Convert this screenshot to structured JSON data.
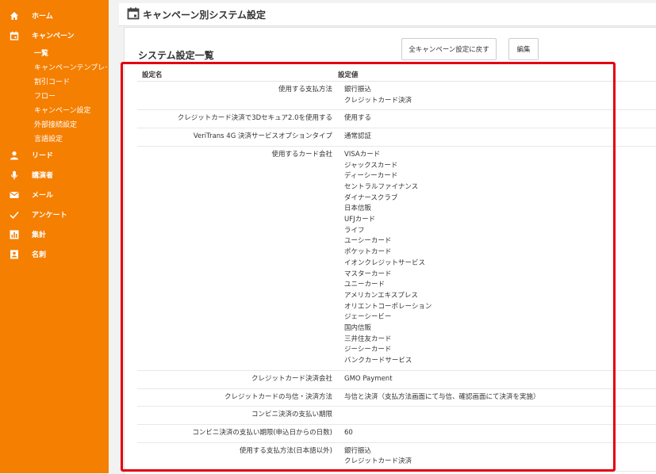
{
  "sidebar": {
    "items": [
      {
        "label": "ホーム",
        "icon": "home-icon"
      },
      {
        "label": "キャンペーン",
        "icon": "calendar-icon"
      },
      {
        "label": "リード",
        "icon": "person-icon"
      },
      {
        "label": "講演者",
        "icon": "microphone-icon"
      },
      {
        "label": "メール",
        "icon": "mail-icon"
      },
      {
        "label": "アンケート",
        "icon": "check-icon"
      },
      {
        "label": "集計",
        "icon": "chart-icon"
      },
      {
        "label": "名刺",
        "icon": "contact-card-icon"
      }
    ],
    "sub_items": [
      {
        "label": "一覧"
      },
      {
        "label": "キャンペーンテンプレート"
      },
      {
        "label": "割引コード"
      },
      {
        "label": "フロー"
      },
      {
        "label": "キャンペーン設定"
      },
      {
        "label": "外部接続設定"
      },
      {
        "label": "言語設定"
      }
    ]
  },
  "header": {
    "title": "キャンペーン別システム設定"
  },
  "main": {
    "section_title": "システム設定一覧",
    "buttons": {
      "reset": "全キャンペーン設定に戻す",
      "edit": "編集"
    },
    "table": {
      "headers": {
        "name": "設定名",
        "value": "設定値"
      },
      "rows": [
        {
          "name": "使用する支払方法",
          "values": [
            "銀行振込",
            "クレジットカード決済"
          ]
        },
        {
          "name": "クレジットカード決済で3Dセキュア2.0を使用する",
          "values": [
            "使用する"
          ]
        },
        {
          "name": "VeriTrans 4G 決済サービスオプションタイプ",
          "values": [
            "通常認証"
          ]
        },
        {
          "name": "使用するカード会社",
          "values": [
            "VISAカード",
            "ジャックスカード",
            "ディーシーカード",
            "セントラルファイナンス",
            "ダイナースクラブ",
            "日本信販",
            "UFJカード",
            "ライフ",
            "ユーシーカード",
            "ポケットカード",
            "イオンクレジットサービス",
            "マスターカード",
            "ユニーカード",
            "アメリカンエキスプレス",
            "オリエントコーポレーション",
            "ジェーシービー",
            "国内信販",
            "三井住友カード",
            "ジーシーカード",
            "バンクカードサービス"
          ]
        },
        {
          "name": "クレジットカード決済会社",
          "values": [
            "GMO Payment"
          ]
        },
        {
          "name": "クレジットカードの与信・決済方法",
          "values": [
            "与信と決済（支払方法画面にて与信、確認画面にて決済を実施）"
          ]
        },
        {
          "name": "コンビニ決済の支払い期限",
          "values": [
            ""
          ]
        },
        {
          "name": "コンビニ決済の支払い期限(申込日からの日数)",
          "values": [
            "60"
          ]
        },
        {
          "name": "使用する支払方法(日本語以外)",
          "values": [
            "銀行振込",
            "クレジットカード決済"
          ]
        }
      ]
    }
  },
  "colors": {
    "sidebar": "#f57f00",
    "highlight": "#e3000f"
  }
}
